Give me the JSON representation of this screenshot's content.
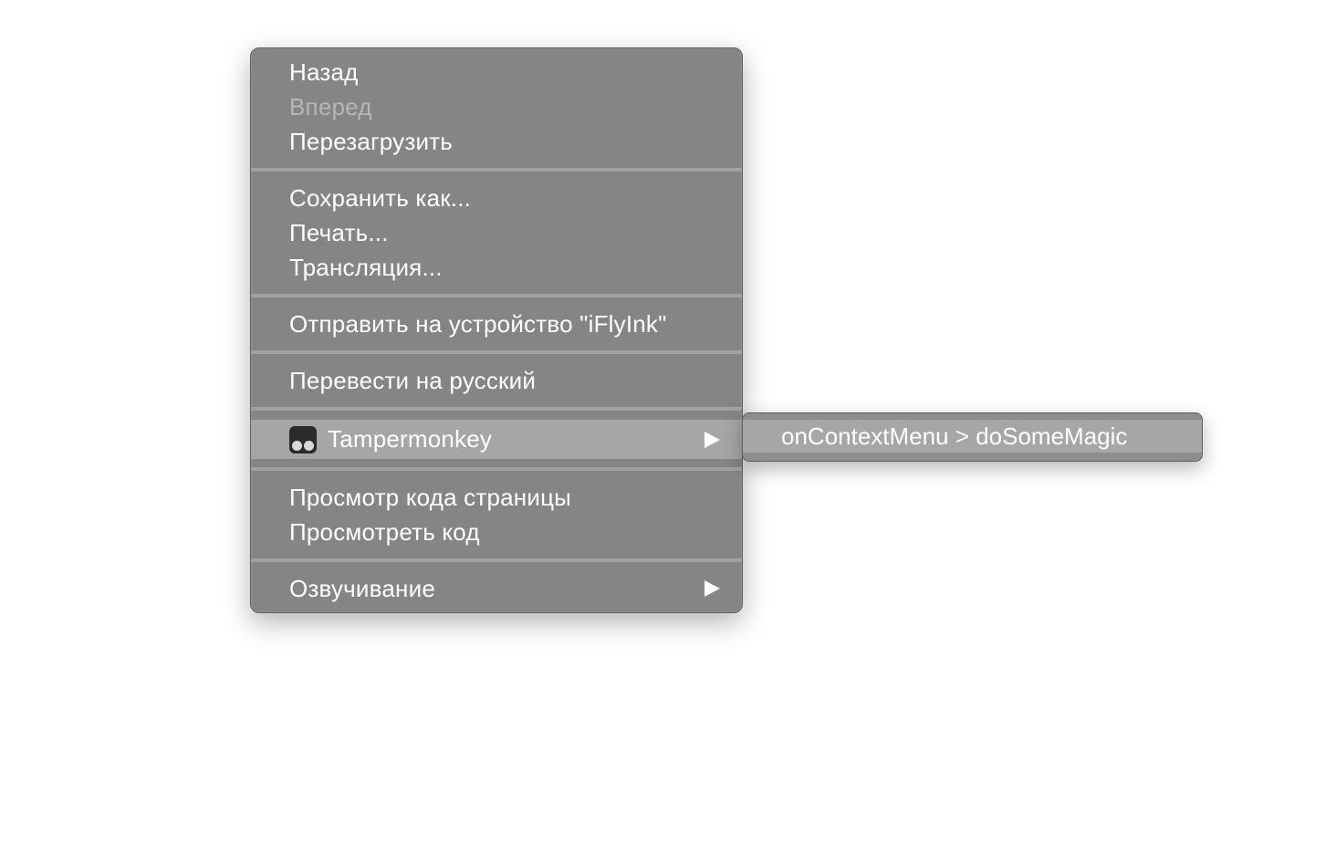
{
  "context_menu": {
    "groups": [
      {
        "items": [
          {
            "label": "Назад",
            "enabled": true
          },
          {
            "label": "Вперед",
            "enabled": false
          },
          {
            "label": "Перезагрузить",
            "enabled": true
          }
        ]
      },
      {
        "items": [
          {
            "label": "Сохранить как...",
            "enabled": true
          },
          {
            "label": "Печать...",
            "enabled": true
          },
          {
            "label": "Трансляция...",
            "enabled": true
          }
        ]
      },
      {
        "items": [
          {
            "label": "Отправить на устройство \"iFlyInk\"",
            "enabled": true
          }
        ]
      },
      {
        "items": [
          {
            "label": "Перевести на русский",
            "enabled": true
          }
        ]
      },
      {
        "items": [
          {
            "label": "Tampermonkey",
            "enabled": true,
            "icon": "tampermonkey-icon",
            "has_submenu": true,
            "selected": true
          }
        ]
      },
      {
        "items": [
          {
            "label": "Просмотр кода страницы",
            "enabled": true
          },
          {
            "label": "Просмотреть код",
            "enabled": true
          }
        ]
      },
      {
        "items": [
          {
            "label": "Озвучивание",
            "enabled": true,
            "has_submenu": true
          }
        ]
      }
    ]
  },
  "submenu": {
    "items": [
      {
        "label": "onContextMenu > doSomeMagic",
        "selected": true
      }
    ]
  },
  "colors": {
    "menu_background": "#858585",
    "selected_background": "#a6a6a6",
    "separator": "#a1a1a1",
    "text": "#ffffff",
    "disabled_text": "#b6b6b6"
  }
}
